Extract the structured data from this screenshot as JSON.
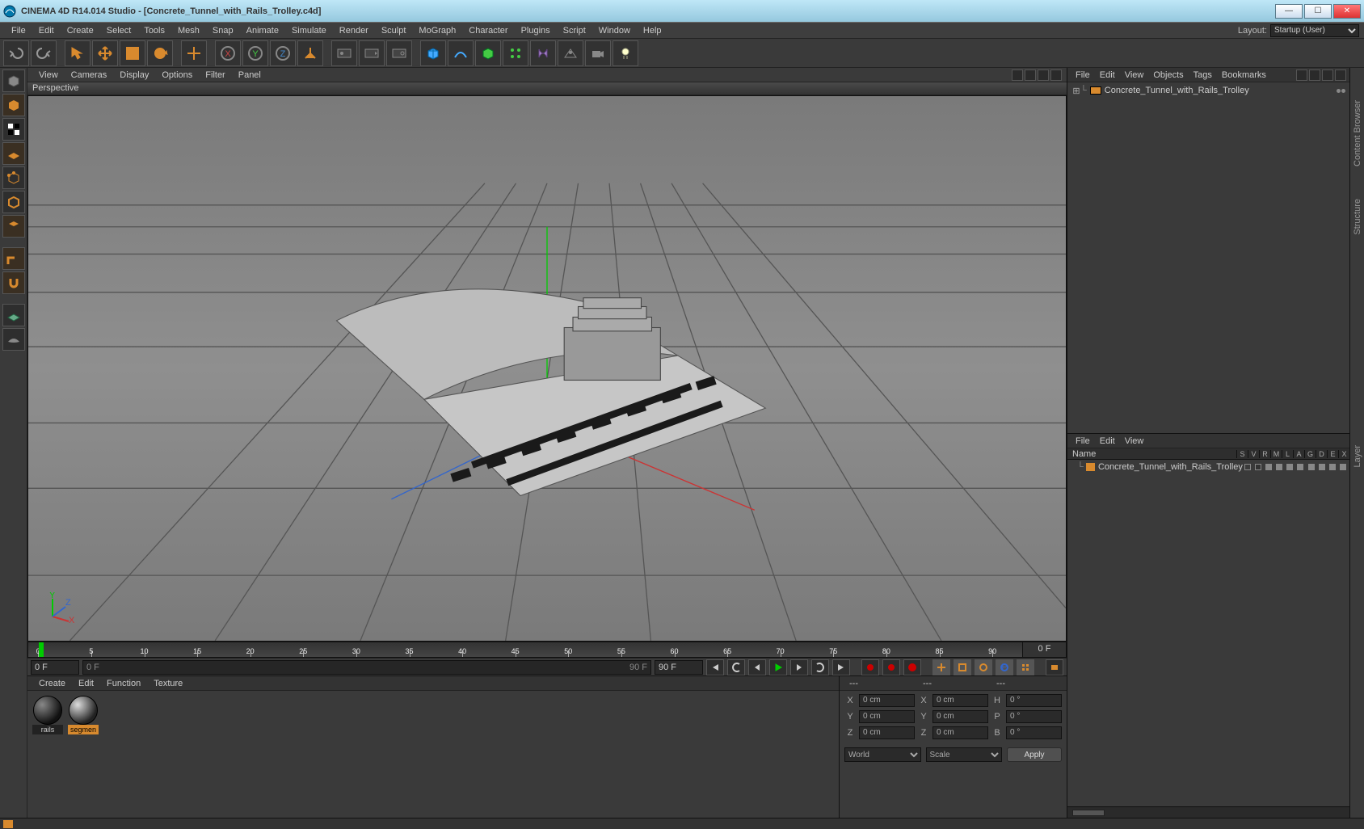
{
  "window": {
    "title": "CINEMA 4D R14.014 Studio - [Concrete_Tunnel_with_Rails_Trolley.c4d]"
  },
  "mainmenu": [
    "File",
    "Edit",
    "Create",
    "Select",
    "Tools",
    "Mesh",
    "Snap",
    "Animate",
    "Simulate",
    "Render",
    "Sculpt",
    "MoGraph",
    "Character",
    "Plugins",
    "Script",
    "Window",
    "Help"
  ],
  "layout": {
    "label": "Layout:",
    "value": "Startup (User)"
  },
  "viewmenu": [
    "View",
    "Cameras",
    "Display",
    "Options",
    "Filter",
    "Panel"
  ],
  "viewport_label": "Perspective",
  "timeline": {
    "ticks": [
      0,
      5,
      10,
      15,
      20,
      25,
      30,
      35,
      40,
      45,
      50,
      55,
      60,
      65,
      70,
      75,
      80,
      85,
      90
    ],
    "endlabel": "0 F"
  },
  "playback": {
    "start_frame": "0 F",
    "track_start": "0 F",
    "track_end": "90 F",
    "end_frame": "90 F"
  },
  "materials": {
    "menu": [
      "Create",
      "Edit",
      "Function",
      "Texture"
    ],
    "slots": [
      {
        "name": "rails",
        "selected": false
      },
      {
        "name": "segmen",
        "selected": true
      }
    ]
  },
  "coord": {
    "menu_dashes": [
      "---",
      "---",
      "---"
    ],
    "rows": [
      {
        "a": "X",
        "av": "0 cm",
        "b": "X",
        "bv": "0 cm",
        "c": "H",
        "cv": "0 °"
      },
      {
        "a": "Y",
        "av": "0 cm",
        "b": "Y",
        "bv": "0 cm",
        "c": "P",
        "cv": "0 °"
      },
      {
        "a": "Z",
        "av": "0 cm",
        "b": "Z",
        "bv": "0 cm",
        "c": "B",
        "cv": "0 °"
      }
    ],
    "space": "World",
    "mode": "Scale",
    "apply": "Apply"
  },
  "objects_panel": {
    "menu": [
      "File",
      "Edit",
      "View",
      "Objects",
      "Tags",
      "Bookmarks"
    ],
    "items": [
      {
        "label": "Concrete_Tunnel_with_Rails_Trolley"
      }
    ]
  },
  "lower_panel": {
    "menu": [
      "File",
      "Edit",
      "View"
    ],
    "header_name": "Name",
    "cols": [
      "S",
      "V",
      "R",
      "M",
      "L",
      "A",
      "G",
      "D",
      "E",
      "X"
    ],
    "rows": [
      {
        "label": "Concrete_Tunnel_with_Rails_Trolley"
      }
    ]
  },
  "sidetabs": [
    "Content Browser",
    "Structure",
    "Layer"
  ]
}
